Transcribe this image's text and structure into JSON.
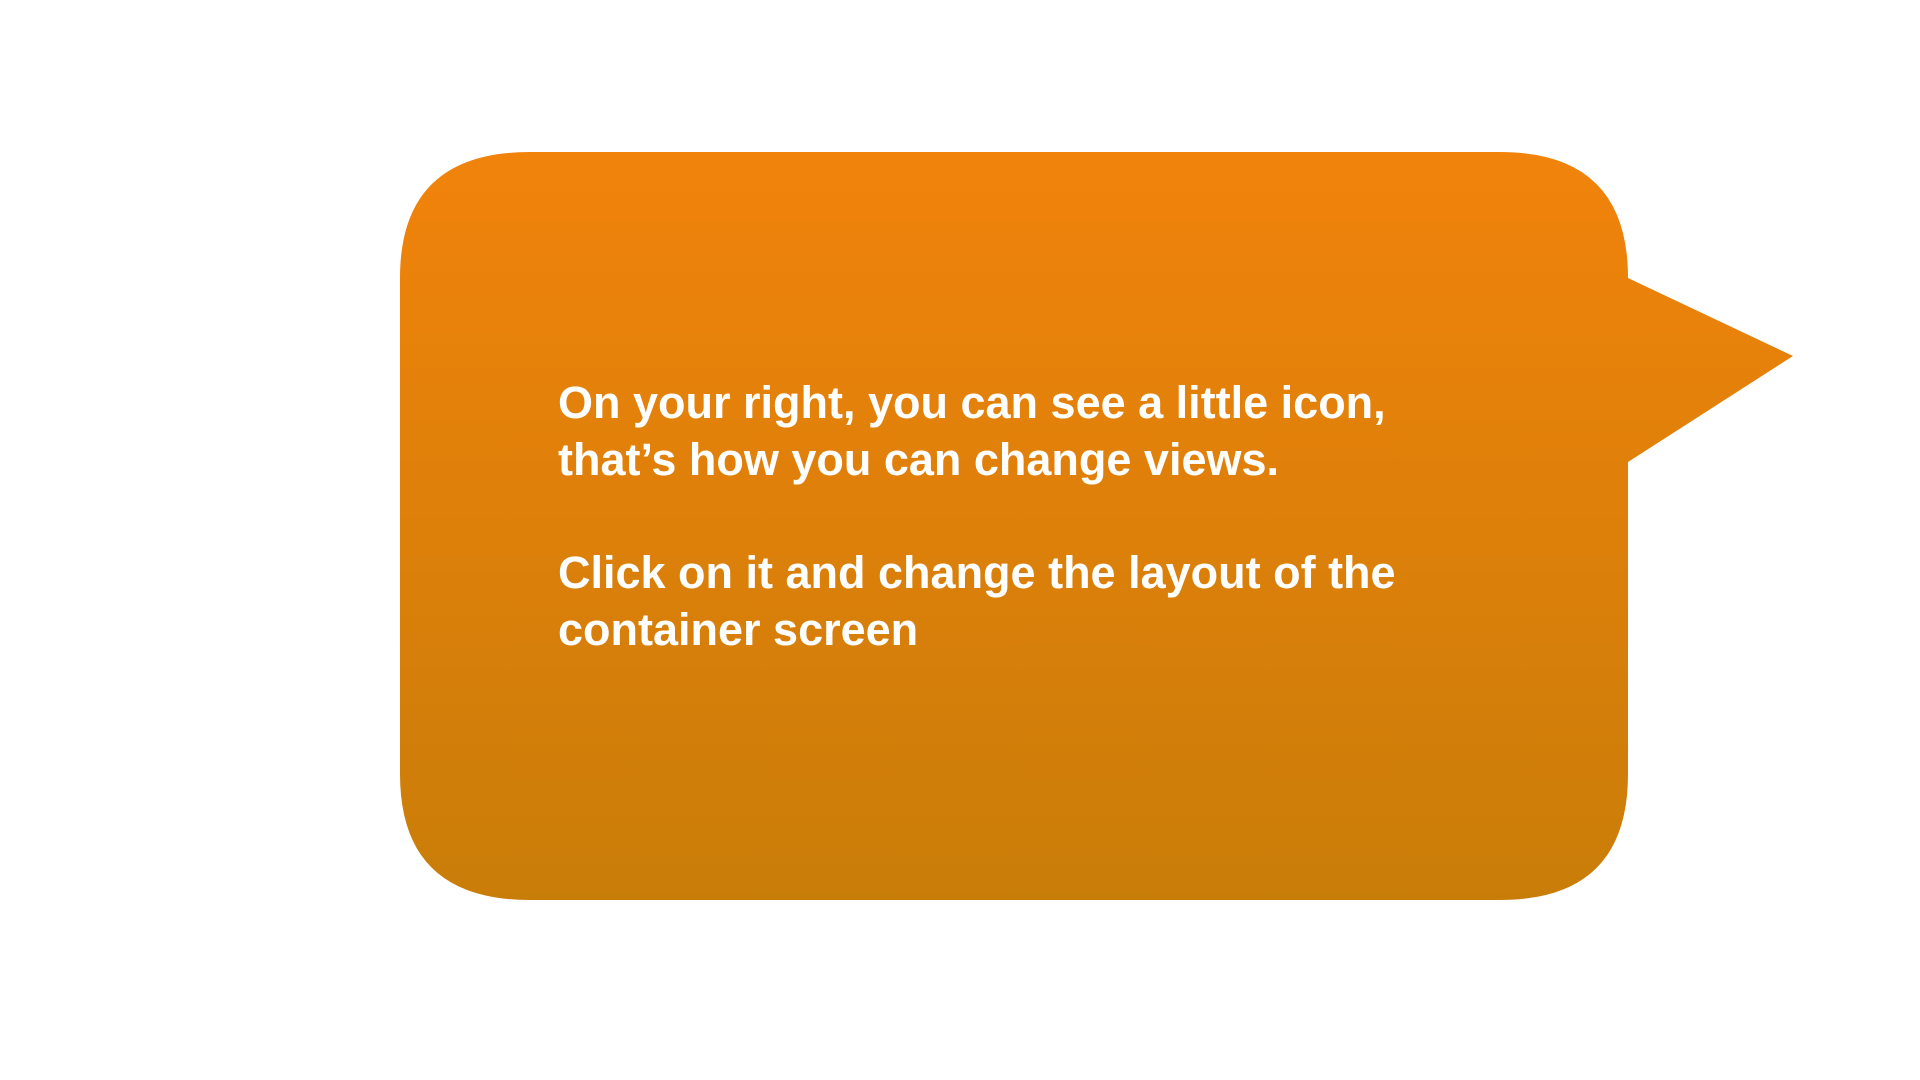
{
  "tooltip": {
    "line1": "On your right, you can see a little icon,\nthat’s how you can change views.",
    "line2": "Click on it and change the layout of the\ncontainer screen"
  },
  "colors": {
    "bubble_top": "#F1830B",
    "bubble_bottom": "#C97D09",
    "text": "#FFFFFF",
    "background": "#FFFFFF"
  }
}
